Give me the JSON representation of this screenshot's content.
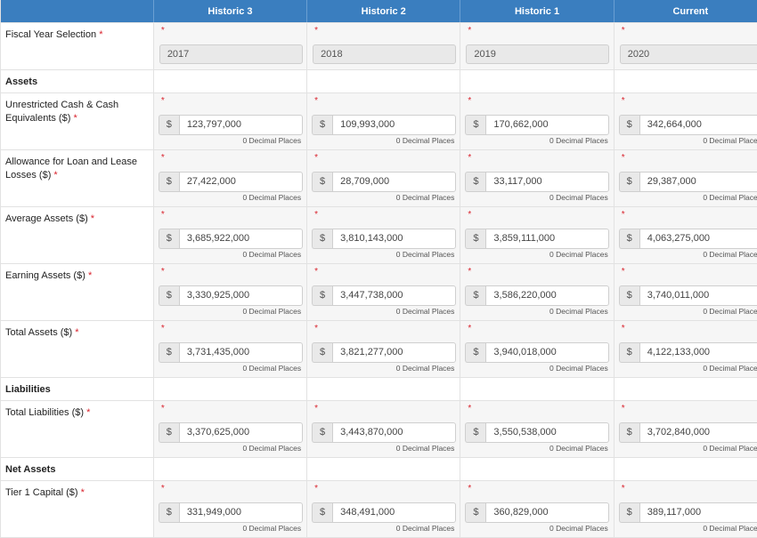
{
  "columns": [
    "Historic 3",
    "Historic 2",
    "Historic 1",
    "Current"
  ],
  "fiscal": {
    "label": "Fiscal Year Selection",
    "years": [
      "2017",
      "2018",
      "2019",
      "2020"
    ]
  },
  "sections": {
    "assets": "Assets",
    "liabilities": "Liabilities",
    "net_assets": "Net Assets"
  },
  "required_mark": "*",
  "currency_symbol": "$",
  "decimal_note": "0 Decimal Places",
  "rows": {
    "cash": {
      "label_line1": "Unrestricted Cash & Cash",
      "label_line2": "Equivalents ($)",
      "values": [
        "123,797,000",
        "109,993,000",
        "170,662,000",
        "342,664,000"
      ]
    },
    "allowance": {
      "label_line1": "Allowance for Loan and Lease",
      "label_line2": "Losses ($)",
      "values": [
        "27,422,000",
        "28,709,000",
        "33,117,000",
        "29,387,000"
      ]
    },
    "average": {
      "label_line1": "Average Assets ($)",
      "values": [
        "3,685,922,000",
        "3,810,143,000",
        "3,859,111,000",
        "4,063,275,000"
      ]
    },
    "earning": {
      "label_line1": "Earning Assets ($)",
      "values": [
        "3,330,925,000",
        "3,447,738,000",
        "3,586,220,000",
        "3,740,011,000"
      ]
    },
    "total_assets": {
      "label_line1": "Total Assets ($)",
      "values": [
        "3,731,435,000",
        "3,821,277,000",
        "3,940,018,000",
        "4,122,133,000"
      ]
    },
    "total_liabilities": {
      "label_line1": "Total Liabilities ($)",
      "values": [
        "3,370,625,000",
        "3,443,870,000",
        "3,550,538,000",
        "3,702,840,000"
      ]
    },
    "tier1": {
      "label_line1": "Tier 1 Capital ($)",
      "values": [
        "331,949,000",
        "348,491,000",
        "360,829,000",
        "389,117,000"
      ]
    }
  }
}
